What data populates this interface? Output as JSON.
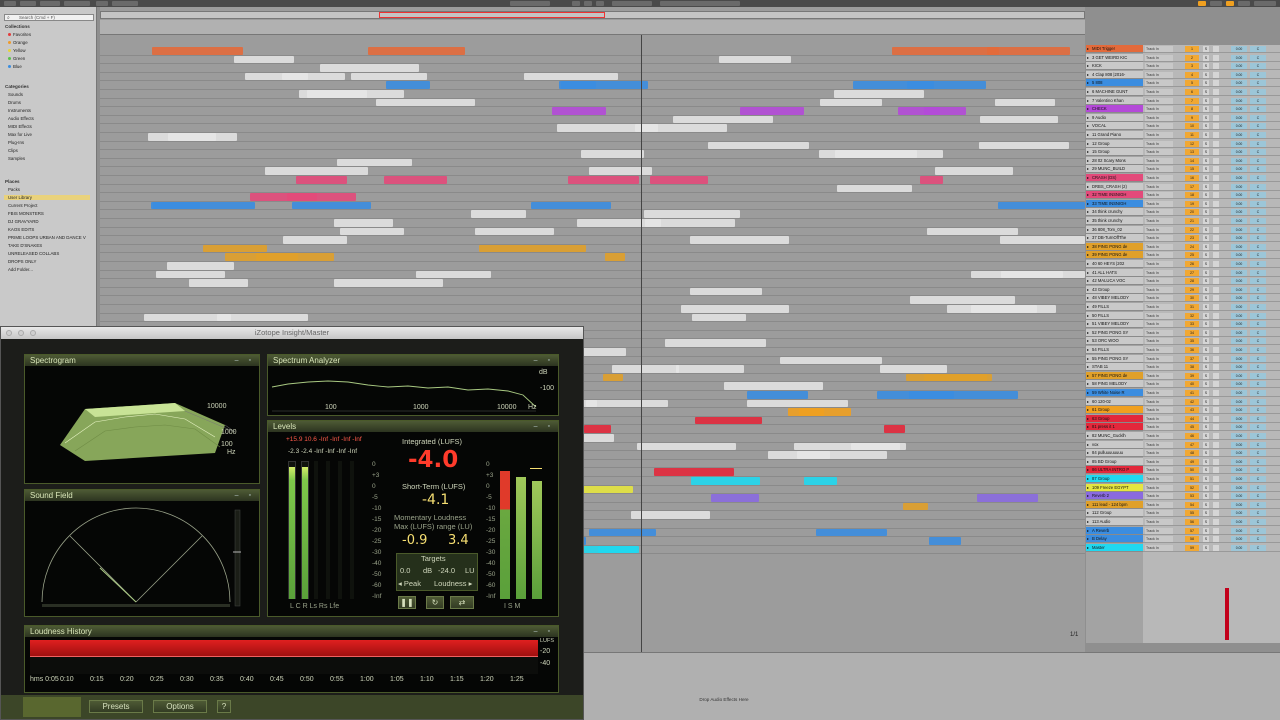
{
  "search": {
    "placeholder": "Search (Cmd + F)"
  },
  "browser": {
    "collections_label": "Collections",
    "collections": [
      {
        "label": "Favorites",
        "color": "#e33b3b"
      },
      {
        "label": "Orange",
        "color": "#f09a2a"
      },
      {
        "label": "Yellow",
        "color": "#e6d33b"
      },
      {
        "label": "Green",
        "color": "#58c24a"
      },
      {
        "label": "Blue",
        "color": "#3b8de0"
      }
    ],
    "categories_label": "Categories",
    "categories": [
      "Sounds",
      "Drums",
      "Instruments",
      "Audio Effects",
      "MIDI Effects",
      "Max for Live",
      "Plug-Ins",
      "Clips",
      "Samples"
    ],
    "places_label": "Places",
    "places": [
      "Packs",
      "User Library",
      "Current Project",
      "FBIS MONSTERS",
      "DJ GRAVYARD",
      "KAOS EDITS",
      "PRIME LOOPS URBAN AND DANCE V",
      "TAKE D'SNAKES",
      "UNRELEASED COLLABS",
      "DROPS ONLY",
      "Add Folder..."
    ]
  },
  "arrangement": {
    "tracks": [
      {
        "name": "MIDI Trigger",
        "color": "#e36a3b"
      },
      {
        "name": "3 GET WEIRD KIC",
        "color": "#c9c9c9"
      },
      {
        "name": "KICK",
        "color": "#c9c9c9"
      },
      {
        "name": "4 Clap 808 |2016-",
        "color": "#c9c9c9"
      },
      {
        "name": "5 808",
        "color": "#3b8de0"
      },
      {
        "name": "6 MACHINE GUNT",
        "color": "#c9c9c9"
      },
      {
        "name": "7 Valentino Khan",
        "color": "#c9c9c9"
      },
      {
        "name": "CHECK",
        "color": "#b44ad8"
      },
      {
        "name": "9 Audio",
        "color": "#c9c9c9"
      },
      {
        "name": "VOCAL",
        "color": "#c9c9c9"
      },
      {
        "name": "11 Grand Piano",
        "color": "#c9c9c9"
      },
      {
        "name": "12 Group",
        "color": "#c9c9c9"
      },
      {
        "name": "15 Group",
        "color": "#c9c9c9"
      },
      {
        "name": "28 02 Scary Mons",
        "color": "#c9c9c9"
      },
      {
        "name": "29 MUNC_BUILD",
        "color": "#c9c9c9"
      },
      {
        "name": "CRASH (DS)",
        "color": "#e34a7a"
      },
      {
        "name": "DRBS_CRASH (2)",
        "color": "#c9c9c9"
      },
      {
        "name": "32 TIME INSNIGH",
        "color": "#e34a7a"
      },
      {
        "name": "33 TIME INSNIGH",
        "color": "#3b8de0"
      },
      {
        "name": "34 think crunchy",
        "color": "#c9c9c9"
      },
      {
        "name": "35 think crunchy",
        "color": "#c9c9c9"
      },
      {
        "name": "36 808_Tom_02",
        "color": "#c9c9c9"
      },
      {
        "name": "37 DB-TurnOffThe",
        "color": "#c9c9c9"
      },
      {
        "name": "38 PING PONG de",
        "color": "#e0a02a"
      },
      {
        "name": "39 PING PONG de",
        "color": "#e0a02a"
      },
      {
        "name": "40 60 HEYS |202",
        "color": "#c9c9c9"
      },
      {
        "name": "41 ALL HATS",
        "color": "#c9c9c9"
      },
      {
        "name": "42 MALUCA VOC",
        "color": "#c9c9c9"
      },
      {
        "name": "43 Group",
        "color": "#c9c9c9"
      },
      {
        "name": "48 VIBEY MELODY",
        "color": "#c9c9c9"
      },
      {
        "name": "49 FILLS",
        "color": "#c9c9c9"
      },
      {
        "name": "50 FILLS",
        "color": "#c9c9c9"
      },
      {
        "name": "51 VIBEY MELODY",
        "color": "#c9c9c9"
      },
      {
        "name": "52 PING PONG SY",
        "color": "#c9c9c9"
      },
      {
        "name": "53 ORC WOO",
        "color": "#c9c9c9"
      },
      {
        "name": "54 FILLS",
        "color": "#c9c9c9"
      },
      {
        "name": "55 PING PONG SY",
        "color": "#c9c9c9"
      },
      {
        "name": "STAB 11",
        "color": "#c9c9c9"
      },
      {
        "name": "57 PING PONG de",
        "color": "#e0a02a"
      },
      {
        "name": "58 PING MELODY",
        "color": "#c9c9c9"
      },
      {
        "name": "59 White Noise R",
        "color": "#3b8de0"
      },
      {
        "name": "60 120-02",
        "color": "#c9c9c9"
      },
      {
        "name": "61 Group",
        "color": "#f0a020"
      },
      {
        "name": "63 Group",
        "color": "#e3283b"
      },
      {
        "name": "81 press it 1",
        "color": "#e3283b"
      },
      {
        "name": "82 MUNC_Gucklh",
        "color": "#c9c9c9"
      },
      {
        "name": "vox",
        "color": "#c9c9c9"
      },
      {
        "name": "84 pulluuuuuuuu",
        "color": "#c9c9c9"
      },
      {
        "name": "85 BD Group",
        "color": "#c9c9c9"
      },
      {
        "name": "86 ULTRA INTRO P",
        "color": "#e3283b"
      },
      {
        "name": "87 Group",
        "color": "#20d8f0"
      },
      {
        "name": "109 Freeze EGYPT",
        "color": "#e6e640"
      },
      {
        "name": "Reverb 2",
        "color": "#8a6ae0"
      },
      {
        "name": "111 lead - 124 bpm",
        "color": "#e0a02a"
      },
      {
        "name": "112 Group",
        "color": "#c9c9c9"
      },
      {
        "name": "113 Audio",
        "color": "#c9c9c9"
      },
      {
        "name": "A Reverb",
        "color": "#3b8de0"
      },
      {
        "name": "B Delay",
        "color": "#3b8de0"
      },
      {
        "name": "Master",
        "color": "#20d8f0"
      }
    ],
    "mixer_input_label": "Track In",
    "mixer_volume": "0.00",
    "mixer_pan": "C",
    "page_indicator": "1/1",
    "drop_label": "Drop Audio Effects Here"
  },
  "insight": {
    "window_title": "iZotope Insight/Master",
    "spectrogram": {
      "title": "Spectrogram",
      "labels": [
        "10000",
        "1000",
        "100",
        "Hz"
      ]
    },
    "spectrum": {
      "title": "Spectrum Analyzer",
      "x_labels": [
        "100",
        "1000",
        "10000",
        "Hz"
      ],
      "y_label": "dB",
      "y_value": "-100"
    },
    "levels": {
      "title": "Levels",
      "peak_row1": "+15.9 10.6 -Inf -Inf -Inf -Inf",
      "peak_row2": "-2.3 -2.4 -Inf -Inf -Inf -Inf",
      "scale": [
        "0",
        "+3",
        "0",
        "-5",
        "-10",
        "-15",
        "-20",
        "-25",
        "-30",
        "-40",
        "-50",
        "-60",
        "-Inf"
      ],
      "channels": "L  C  R  Ls Rs Lfe",
      "integrated_label": "Integrated (LUFS)",
      "integrated_value": "-4.0",
      "short_term_label": "Short-Term (LUFS)",
      "short_term_value": "-4.1",
      "momentary_label": "Momentary  Loudness",
      "momentary_label2": "Max (LUFS) range (LU)",
      "momentary_value": "-0.9",
      "range_value": "3.4",
      "targets_label": "Targets",
      "target_db": "0.0",
      "target_db_unit": "dB",
      "target_lu": "-24.0",
      "target_lu_unit": "LU",
      "peak_tab": "Peak",
      "loudness_tab": "Loudness",
      "meter_labels": "I   S   M"
    },
    "soundfield": {
      "title": "Sound Field"
    },
    "history": {
      "title": "Loudness History",
      "unit": "LUFS",
      "y_labels": [
        "-20",
        "-40"
      ],
      "x_labels": [
        "hms 0:05",
        "0:10",
        "0:15",
        "0:20",
        "0:25",
        "0:30",
        "0:35",
        "0:40",
        "0:45",
        "0:50",
        "0:55",
        "1:00",
        "1:05",
        "1:10",
        "1:15",
        "1:20",
        "1:25"
      ]
    },
    "footer": {
      "presets": "Presets",
      "options": "Options",
      "help": "?"
    }
  },
  "colors": {
    "accent_orange": "#f0a020",
    "loudness_red": "#ff3b2b",
    "meter_green": "#7ec84a"
  }
}
